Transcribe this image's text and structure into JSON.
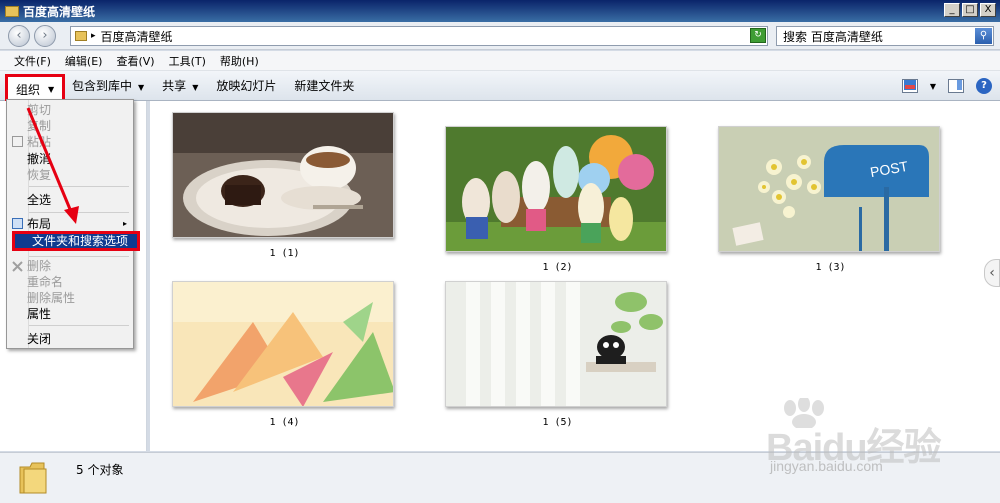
{
  "window": {
    "title": "百度高清壁纸",
    "min": "_",
    "max": "□",
    "close": "X"
  },
  "nav": {
    "back": "‹",
    "forward": "›"
  },
  "address": {
    "arrow": "▸",
    "path": "百度高清壁纸",
    "dropdown": "▼",
    "refresh": "↻"
  },
  "search": {
    "placeholder": "搜索 百度高清壁纸",
    "icon_glyph": "⚲"
  },
  "menubar": [
    "文件(F)",
    "编辑(E)",
    "查看(V)",
    "工具(T)",
    "帮助(H)"
  ],
  "toolbar": {
    "organize": "组织",
    "include_library": "包含到库中",
    "share": "共享",
    "slideshow": "放映幻灯片",
    "new_folder": "新建文件夹",
    "caret": "▼",
    "help": "?"
  },
  "context_menu": {
    "cut": "剪切",
    "copy": "复制",
    "paste": "粘贴",
    "undo": "撤消",
    "redo": "恢复",
    "select_all": "全选",
    "layout": "布局",
    "submenu_arrow": "▸",
    "folder_options": "文件夹和搜索选项",
    "delete": "删除",
    "rename": "重命名",
    "remove_properties": "删除属性",
    "properties": "属性",
    "close": "关闭"
  },
  "thumbnails": [
    {
      "caption": "1 (1)"
    },
    {
      "caption": "1 (2)"
    },
    {
      "caption": "1 (3)",
      "sign_text": "POST"
    },
    {
      "caption": "1 (4)"
    },
    {
      "caption": "1 (5)"
    }
  ],
  "scroll_glyph": "‹",
  "status": {
    "count": "5 个对象"
  },
  "watermark": {
    "brand": "Baidu经验",
    "url": "jingyan.baidu.com"
  },
  "colors": {
    "highlight": "#0f3b8f",
    "annotation_red": "#e60012",
    "title_bar": "#0a246a"
  }
}
